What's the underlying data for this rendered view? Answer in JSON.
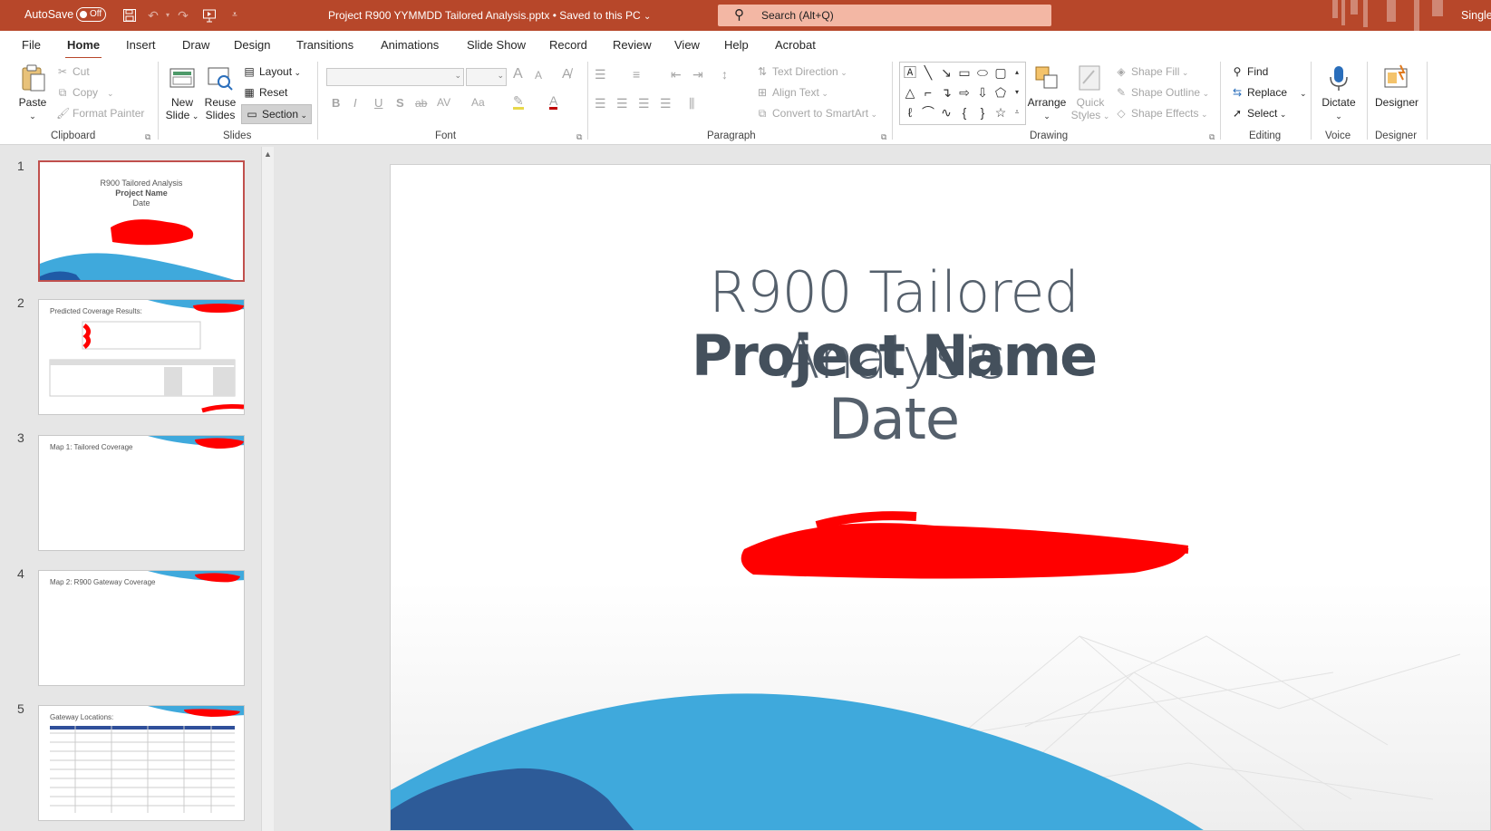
{
  "titlebar": {
    "autosave_label": "AutoSave",
    "autosave_state": "Off",
    "document_title": "Project R900 YYMMDD Tailored Analysis.pptx",
    "save_status": "Saved to this PC",
    "search_placeholder": "Search (Alt+Q)",
    "user": "Single",
    "accent_color": "#b7472a"
  },
  "menu": {
    "tabs": [
      "File",
      "Home",
      "Insert",
      "Draw",
      "Design",
      "Transitions",
      "Animations",
      "Slide Show",
      "Record",
      "Review",
      "View",
      "Help",
      "Acrobat"
    ],
    "active": "Home"
  },
  "ribbon": {
    "clipboard": {
      "label": "Clipboard",
      "paste": "Paste",
      "cut": "Cut",
      "copy": "Copy",
      "format_painter": "Format Painter"
    },
    "slides": {
      "label": "Slides",
      "new_slide_1": "New",
      "new_slide_2": "Slide",
      "reuse_1": "Reuse",
      "reuse_2": "Slides",
      "layout": "Layout",
      "reset": "Reset",
      "section": "Section"
    },
    "font": {
      "label": "Font",
      "bold": "B",
      "italic": "I",
      "underline": "U",
      "shadow": "S",
      "strike": "ab",
      "spacing": "AV",
      "case": "Aa",
      "font_color": "A",
      "grow": "A",
      "shrink": "A"
    },
    "paragraph": {
      "label": "Paragraph",
      "text_direction": "Text Direction",
      "align_text": "Align Text",
      "smartart": "Convert to SmartArt"
    },
    "drawing": {
      "label": "Drawing",
      "arrange": "Arrange",
      "quick_styles_1": "Quick",
      "quick_styles_2": "Styles",
      "shape_fill": "Shape Fill",
      "shape_outline": "Shape Outline",
      "shape_effects": "Shape Effects"
    },
    "editing": {
      "label": "Editing",
      "find": "Find",
      "replace": "Replace",
      "select": "Select"
    },
    "voice": {
      "label": "Voice",
      "dictate": "Dictate"
    },
    "designer": {
      "label": "Designer",
      "designer": "Designer"
    }
  },
  "thumbnails": [
    {
      "num": "1",
      "line1": "R900 Tailored Analysis",
      "line2": "Project Name",
      "line3": "Date"
    },
    {
      "num": "2",
      "title": "Predicted Coverage Results:"
    },
    {
      "num": "3",
      "title": "Map 1: Tailored Coverage"
    },
    {
      "num": "4",
      "title": "Map 2: R900 Gateway Coverage"
    },
    {
      "num": "5",
      "title": "Gateway Locations:"
    }
  ],
  "slide": {
    "title": "R900 Tailored Analysis",
    "project": "Project Name",
    "date": "Date",
    "wave_color_light": "#3fa9dc",
    "wave_color_dark": "#1f5aa6",
    "redaction_color": "#ff0000"
  }
}
